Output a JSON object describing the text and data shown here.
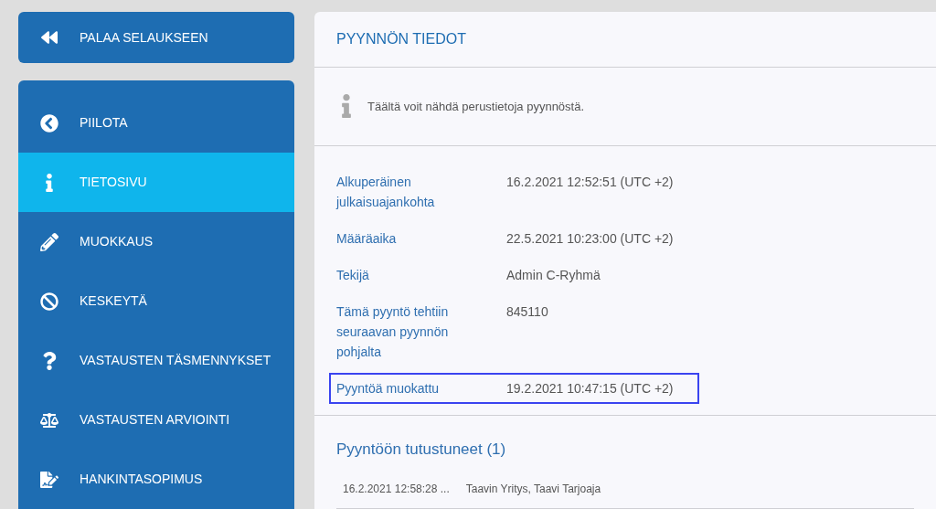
{
  "back_button": {
    "label": "PALAA SELAUKSEEN"
  },
  "menu": [
    {
      "label": "PIILOTA",
      "selected": false
    },
    {
      "label": "TIETOSIVU",
      "selected": true
    },
    {
      "label": "MUOKKAUS",
      "selected": false
    },
    {
      "label": "KESKEYTÄ",
      "selected": false
    },
    {
      "label": "VASTAUSTEN TÄSMENNYKSET",
      "selected": false
    },
    {
      "label": "VASTAUSTEN ARVIOINTI",
      "selected": false
    },
    {
      "label": "HANKINTASOPIMUS",
      "selected": false
    }
  ],
  "panel": {
    "title": "PYYNNÖN TIEDOT",
    "info": "Täältä voit nähdä perustietoja pyynnöstä.",
    "details": [
      {
        "label": "Alkuperäinen julkaisuajankohta",
        "value": "16.2.2021 12:52:51 (UTC +2)",
        "highlighted": false
      },
      {
        "label": "Määräaika",
        "value": "22.5.2021 10:23:00 (UTC +2)",
        "highlighted": false
      },
      {
        "label": "Tekijä",
        "value": "Admin C-Ryhmä",
        "highlighted": false
      },
      {
        "label": "Tämä pyyntö tehtiin seuraavan pyynnön pohjalta",
        "value": "845110",
        "highlighted": false
      },
      {
        "label": "Pyyntöä muokattu",
        "value": "19.2.2021 10:47:15 (UTC +2)",
        "highlighted": true
      }
    ],
    "viewers": {
      "title": "Pyyntöön tutustuneet (1)",
      "rows": [
        {
          "time": "16.2.2021 12:58:28 ...",
          "name": "Taavin Yritys, Taavi Tarjoaja"
        }
      ]
    }
  }
}
